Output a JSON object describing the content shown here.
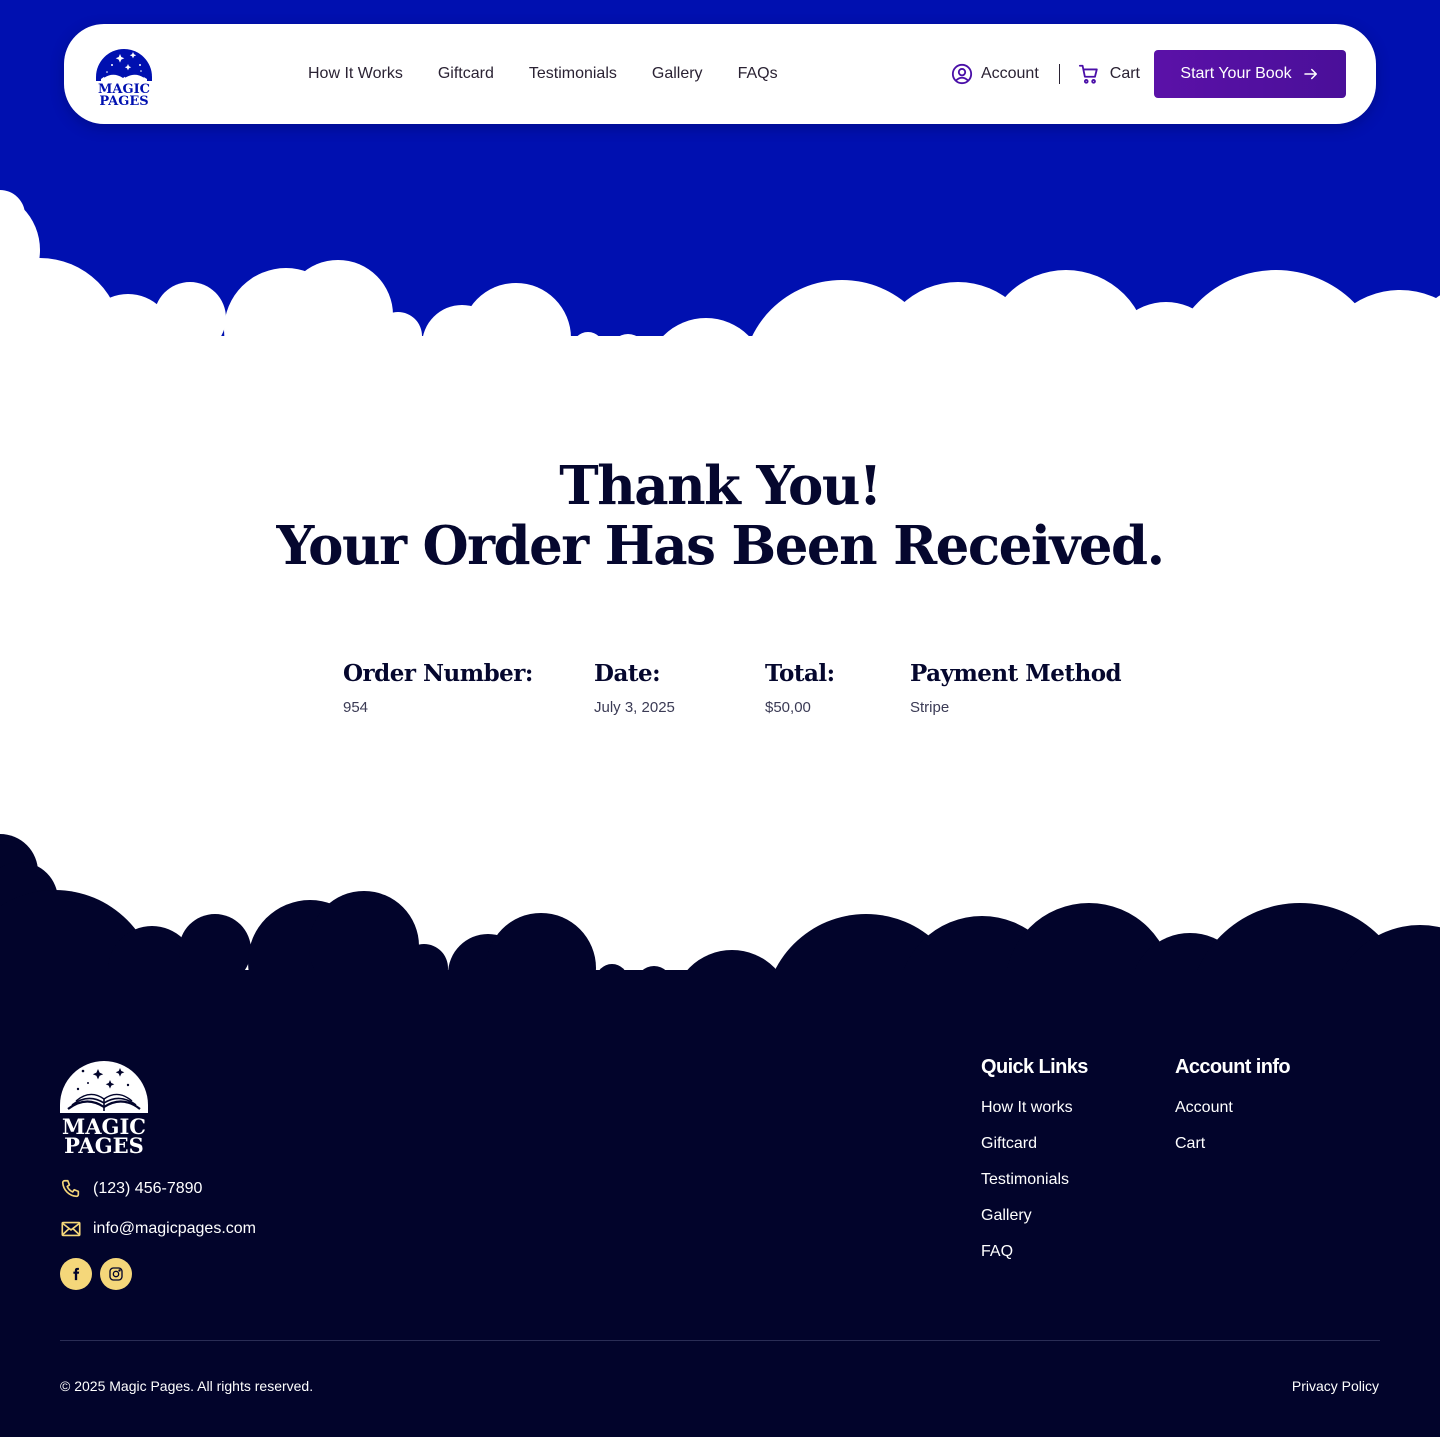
{
  "brand": {
    "name_line1": "MAGIC",
    "name_line2": "PAGES"
  },
  "nav": {
    "links": [
      "How It Works",
      "Giftcard",
      "Testimonials",
      "Gallery",
      "FAQs"
    ],
    "account_label": "Account",
    "cart_label": "Cart",
    "cta_label": "Start Your Book"
  },
  "main": {
    "title_line1": "Thank You!",
    "title_line2": "Your Order Has Been Received.",
    "order": {
      "number_label": "Order Number:",
      "number_value": "954",
      "date_label": "Date:",
      "date_value": "July 3, 2025",
      "total_label": "Total:",
      "total_value": "$50,00",
      "payment_label": "Payment Method",
      "payment_value": "Stripe"
    }
  },
  "footer": {
    "phone": "(123) 456-7890",
    "email": "info@magicpages.com",
    "quick_links": {
      "title": "Quick Links",
      "items": [
        "How It works",
        "Giftcard",
        "Testimonials",
        "Gallery",
        "FAQ"
      ]
    },
    "account_info": {
      "title": "Account info",
      "items": [
        "Account",
        "Cart"
      ]
    },
    "copyright": "© 2025 Magic Pages. All rights reserved.",
    "privacy": "Privacy Policy"
  },
  "icons": {
    "account": "user-circle-icon",
    "cart": "shopping-cart-icon",
    "cta": "arrow-right-icon",
    "phone": "phone-icon",
    "email": "envelope-icon",
    "facebook": "facebook-icon",
    "instagram": "instagram-icon"
  },
  "colors": {
    "hero_blue": "#0010b0",
    "navy": "#02042b",
    "cta_purple": "#5b11a8",
    "accent_yellow": "#f5d77a"
  }
}
